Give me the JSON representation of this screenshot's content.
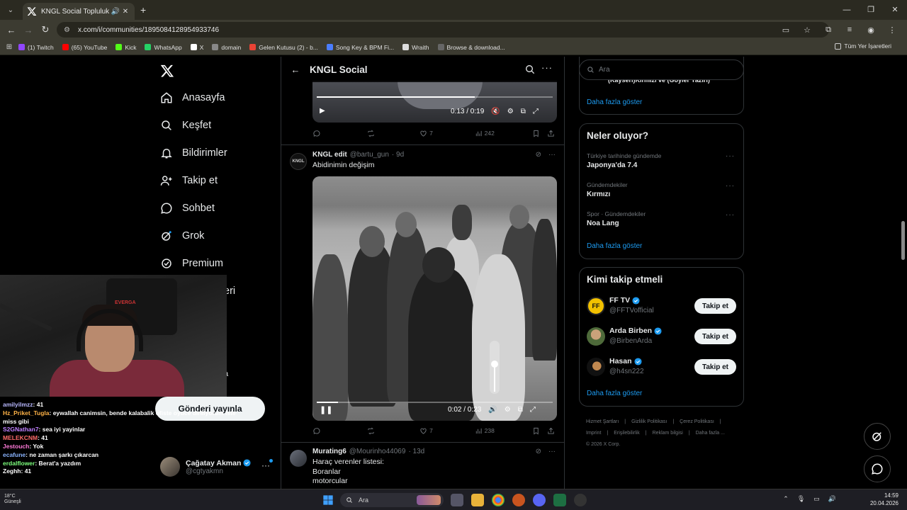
{
  "browser": {
    "tab_title": "KNGL Social Topluluk / X",
    "url": "x.com/i/communities/1895084128954933746",
    "bookmarks": [
      {
        "label": "(1) Twitch",
        "color": "#9146ff"
      },
      {
        "label": "(65) YouTube",
        "color": "#ff0000"
      },
      {
        "label": "Kick",
        "color": "#53fc18"
      },
      {
        "label": "WhatsApp",
        "color": "#25d366"
      },
      {
        "label": "X",
        "color": "#ffffff"
      },
      {
        "label": "domain",
        "color": "#888888"
      },
      {
        "label": "Gelen Kutusu (2) - b...",
        "color": "#ea4335"
      },
      {
        "label": "Song Key & BPM Fi...",
        "color": "#4a7dff"
      },
      {
        "label": "Wraith",
        "color": "#dddddd"
      },
      {
        "label": "Browse & download...",
        "color": "#666666"
      }
    ],
    "all_bookmarks": "Tüm Yer İşaretleri"
  },
  "nav": {
    "items": [
      {
        "label": "Anasayfa",
        "icon": "home-icon"
      },
      {
        "label": "Keşfet",
        "icon": "search-icon"
      },
      {
        "label": "Bildirimler",
        "icon": "bell-icon"
      },
      {
        "label": "Takip et",
        "icon": "follow-icon"
      },
      {
        "label": "Sohbet",
        "icon": "chat-icon"
      },
      {
        "label": "Grok",
        "icon": "grok-icon"
      },
      {
        "label": "Premium",
        "icon": "premium-icon"
      }
    ],
    "partial_label": "eri",
    "partial_label2": "a",
    "post_button": "Gönderi yayınla",
    "account": {
      "name": "Çağatay Akman",
      "handle": "@cgtyakmn"
    }
  },
  "feed": {
    "title": "KNGL Social",
    "post1": {
      "time": "0:13 / 0:19",
      "progress": 0.67,
      "replies": "",
      "reposts": "",
      "likes": "7",
      "views": "242"
    },
    "post2": {
      "name": "KNGL edit",
      "handle": "@bartu_gun",
      "age": "· 9d",
      "text": "Abidinimin değişim",
      "time": "0:02 / 0:23",
      "progress": 0.09,
      "likes": "7",
      "views": "238"
    },
    "post3": {
      "name": "Murating6",
      "handle": "@Mourinho44069",
      "age": "· 13d",
      "lines": [
        "Haraç verenler listesi:",
        "Boranlar",
        "motorcular"
      ]
    }
  },
  "right": {
    "search_placeholder": "Ara",
    "cut_text": "(Kayseri)Kirmizi ve (Goyler Yaziri)",
    "show_more": "Daha fazla göster",
    "trends_title": "Neler oluyor?",
    "trends": [
      {
        "meta": "Türkiye tarihinde gündemde",
        "name": "Japonya'da 7.4"
      },
      {
        "meta": "Gündemdekiler",
        "name": "Kırmızı"
      },
      {
        "meta": "Spor · Gündemdekiler",
        "name": "Noa Lang"
      }
    ],
    "wtf_title": "Kimi takip etmeli",
    "wtf": [
      {
        "name": "FF TV",
        "handle": "@FFTVofficial",
        "button": "Takip et"
      },
      {
        "name": "Arda Birben",
        "handle": "@BirbenArda",
        "button": "Takip et"
      },
      {
        "name": "Hasan",
        "handle": "@h4sn222",
        "button": "Takip et"
      }
    ],
    "footer": [
      "Hizmet Şartları",
      "|",
      "Gizlilik Politikası",
      "|",
      "Çerez Politikası",
      "|",
      "Imprint",
      "|",
      "Erişilebilirlik",
      "|",
      "Reklam bilgisi",
      "|",
      "Daha fazla ...",
      "© 2026 X Corp."
    ]
  },
  "stream": {
    "chair_brand": "EVERGA",
    "chat": [
      {
        "user": "amilyilmzz",
        "color": "#b8b8ff",
        "msg": ": 41"
      },
      {
        "user": "Hz_Priket_Tugla",
        "color": "#ffb347",
        "msg": ": eywallah canimsin, bende kalabalik ofiste oyuce diriliyorum iste"
      },
      {
        "user": "",
        "color": "#ffffff",
        "msg": "miss gibi"
      },
      {
        "user": "S2GNathan7",
        "color": "#c080ff",
        "msg": ": sea iyi yayinlar"
      },
      {
        "user": "MELEKCNM",
        "color": "#ff6b6b",
        "msg": ": 41"
      },
      {
        "user": "Jestouch",
        "color": "#ff7ad9",
        "msg": ": Yok"
      },
      {
        "user": "ecafune",
        "color": "#8ab4ff",
        "msg": ": ne zaman şarkı çıkarcan"
      },
      {
        "user": "erdalflower",
        "color": "#7dff7d",
        "msg": ": Berat'a yazdım"
      },
      {
        "user": "Zeghh",
        "color": "#ffffff",
        "msg": ": 41"
      }
    ]
  },
  "taskbar": {
    "weather_temp": "18°C",
    "weather_text": "Güneşli",
    "search": "Ara",
    "time": "14:59",
    "date": "20.04.2026"
  }
}
